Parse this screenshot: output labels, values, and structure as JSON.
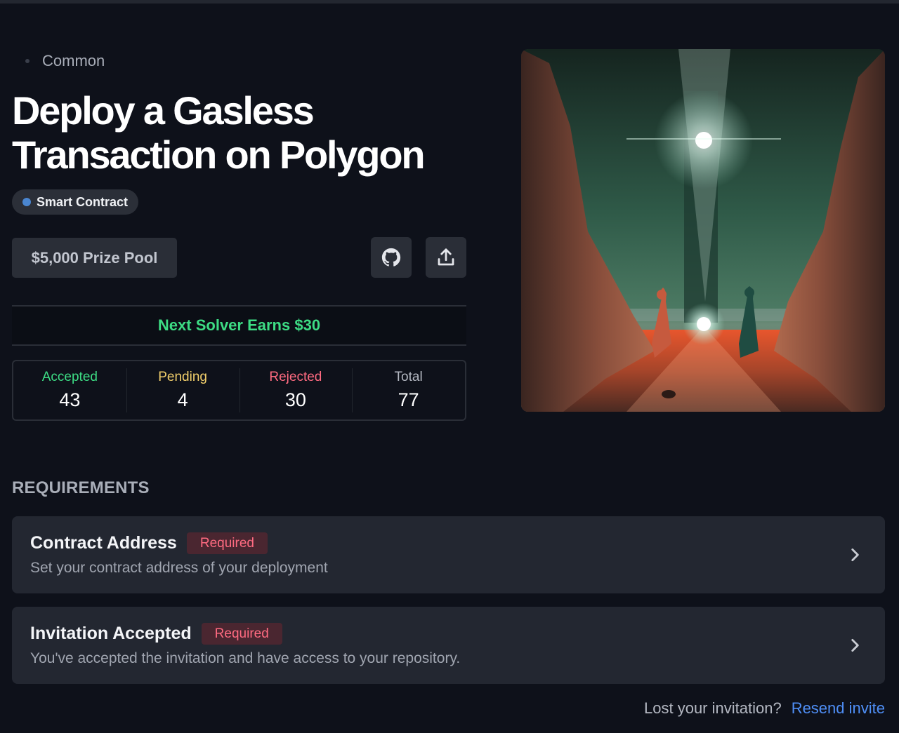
{
  "challenge": {
    "rarity": "Common",
    "title": "Deploy a Gasless Transaction on Polygon",
    "tag": {
      "label": "Smart Contract",
      "color": "#4a86d0"
    },
    "prize_pool": "$5,000 Prize Pool",
    "actions": {
      "github_icon": "github-icon",
      "share_icon": "share-upload-icon"
    },
    "next_solver": "Next Solver Earns $30",
    "stats": [
      {
        "label": "Accepted",
        "value": "43",
        "color": "#3ddc84"
      },
      {
        "label": "Pending",
        "value": "4",
        "color": "#f2cf6b"
      },
      {
        "label": "Rejected",
        "value": "30",
        "color": "#ff6b81"
      },
      {
        "label": "Total",
        "value": "77",
        "color": "#b4b8c2"
      }
    ]
  },
  "requirements": {
    "heading": "REQUIREMENTS",
    "items": [
      {
        "title": "Contract Address",
        "badge": "Required",
        "description": "Set your contract address of your deployment"
      },
      {
        "title": "Invitation Accepted",
        "badge": "Required",
        "description": "You've accepted the invitation and have access to your repository."
      }
    ]
  },
  "footer": {
    "question": "Lost your invitation?",
    "link": "Resend invite"
  }
}
